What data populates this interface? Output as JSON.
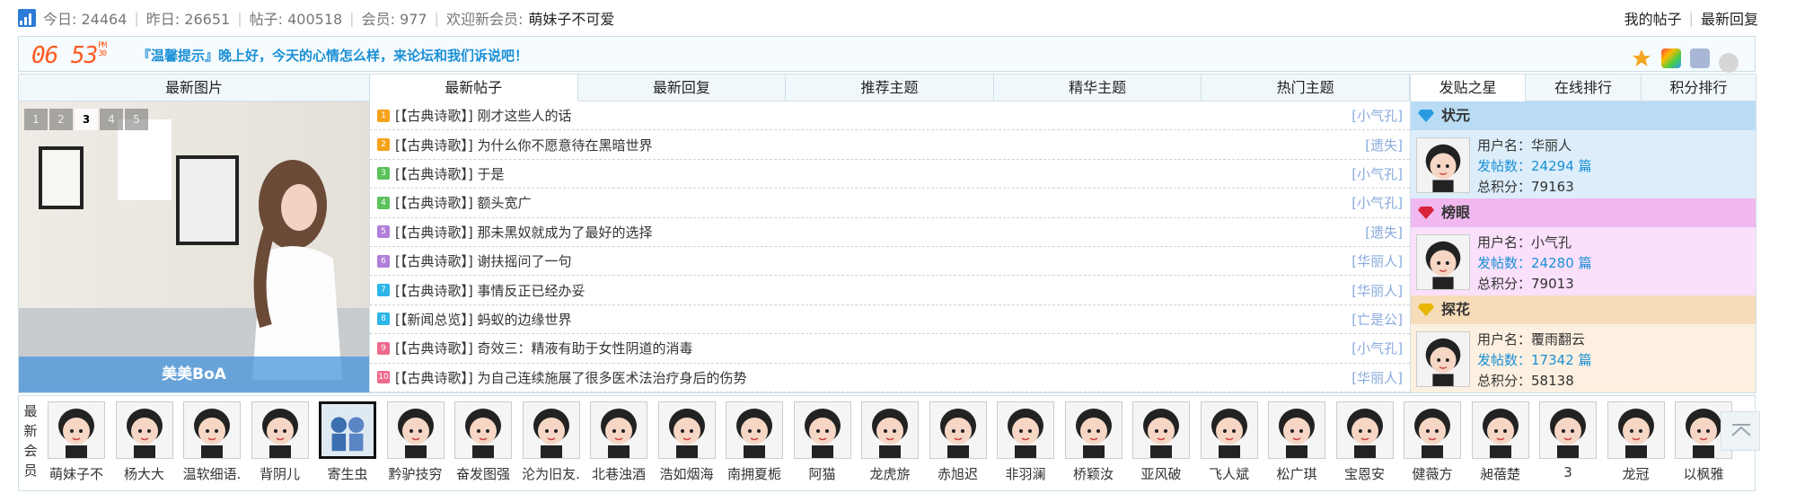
{
  "stats": {
    "today_label": "今日:",
    "today": "24464",
    "yesterday_label": "昨日:",
    "yesterday": "26651",
    "posts_label": "帖子:",
    "posts": "400518",
    "members_label": "会员:",
    "members": "977",
    "welcome_label": "欢迎新会员:",
    "welcome_name": "萌妹子不可爱"
  },
  "top_links": [
    "我的帖子",
    "最新回复"
  ],
  "clock": {
    "hh": "06",
    "mm": "53",
    "ampm": "PM",
    "ss": "30"
  },
  "tip": "『温馨提示』晚上好，今天的心情怎么样，来论坛和我们诉说吧！",
  "left": {
    "title": "最新图片",
    "pages": [
      "1",
      "2",
      "3",
      "4",
      "5"
    ],
    "active_page": "3",
    "caption": "美美BoA"
  },
  "tabs": [
    "最新帖子",
    "最新回复",
    "推荐主题",
    "精华主题",
    "热门主题"
  ],
  "posts": [
    {
      "n": "1",
      "title": "[【古典诗歌】] 刚才这些人的话",
      "author": "[小气孔]",
      "color": "#f7a21b"
    },
    {
      "n": "2",
      "title": "[【古典诗歌】] 为什么你不愿意待在黑暗世界",
      "author": "[遗失]",
      "color": "#f7a21b"
    },
    {
      "n": "3",
      "title": "[【古典诗歌】] 于是",
      "author": "[小气孔]",
      "color": "#5bc25b"
    },
    {
      "n": "4",
      "title": "[【古典诗歌】] 额头宽广",
      "author": "[小气孔]",
      "color": "#5bc25b"
    },
    {
      "n": "5",
      "title": "[【古典诗歌】] 那未黑奴就成为了最好的选择",
      "author": "[遗失]",
      "color": "#b07fd8"
    },
    {
      "n": "6",
      "title": "[【古典诗歌】] 谢扶摇问了一句",
      "author": "[华丽人]",
      "color": "#b07fd8"
    },
    {
      "n": "7",
      "title": "[【古典诗歌】] 事情反正已经办妥",
      "author": "[华丽人]",
      "color": "#2bb5e8"
    },
    {
      "n": "8",
      "title": "[【新闻总览】] 蚂蚁的边缘世界",
      "author": "[亡是公]",
      "color": "#2bb5e8"
    },
    {
      "n": "9",
      "title": "[【古典诗歌】] 奇效三：精液有助于女性阴道的消毒",
      "author": "[小气孔]",
      "color": "#ee6a8c"
    },
    {
      "n": "10",
      "title": "[【古典诗歌】] 为自己连续施展了很多医术法治疗身后的伤势",
      "author": "[华丽人]",
      "color": "#ee6a8c"
    }
  ],
  "right_tabs": [
    "发贴之星",
    "在线排行",
    "积分排行"
  ],
  "ranks": [
    {
      "title": "状元",
      "user_label": "用户名：",
      "user": "华丽人",
      "count_label": "发帖数：",
      "count": "24294 篇",
      "score_label": "总积分：",
      "score": "79163",
      "bg": "#b9dcf4",
      "body": "#ddeefa",
      "gem": "#2a9be0"
    },
    {
      "title": "榜眼",
      "user_label": "用户名：",
      "user": "小气孔",
      "count_label": "发帖数：",
      "count": "24280 篇",
      "score_label": "总积分：",
      "score": "79013",
      "bg": "#f0b8ef",
      "body": "#fae0fa",
      "gem": "#d8233a"
    },
    {
      "title": "探花",
      "user_label": "用户名：",
      "user": "覆雨翻云",
      "count_label": "发帖数：",
      "count": "17342 篇",
      "score_label": "总积分：",
      "score": "58138",
      "bg": "#f7dcb8",
      "body": "#fdf0e0",
      "gem": "#e8b500"
    }
  ],
  "members_label": "最新会员",
  "members": [
    "萌妹子不",
    "杨大大",
    "温软细语.",
    "背阴儿",
    "寄生虫",
    "黔驴技穷",
    "奋发图强",
    "沦为旧友.",
    "北巷浊酒",
    "浩如烟海",
    "南拥夏栀",
    "阿猫",
    "龙虎旂",
    "赤旭迟",
    "非羽澜",
    "桥颖汝",
    "亚风破",
    "飞人斌",
    "松广琪",
    "宝恩安",
    "健薇方",
    "昶蓓楚",
    "3",
    "龙冠",
    "以枫雅"
  ]
}
